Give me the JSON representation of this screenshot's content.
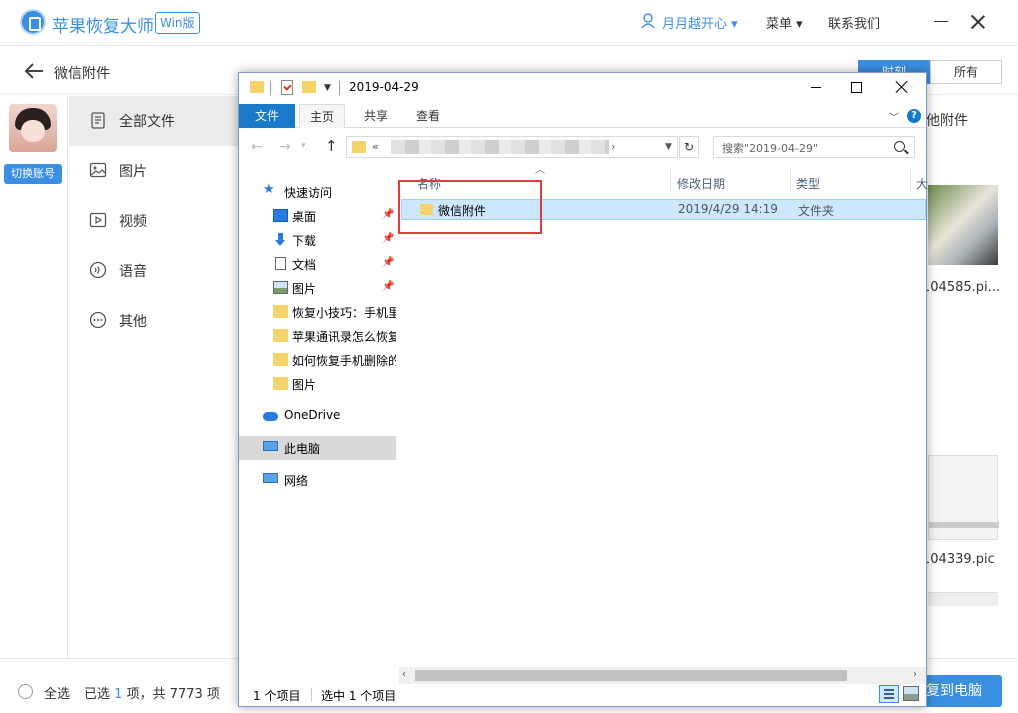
{
  "app": {
    "name": "苹果恢复大师",
    "badge": "Win版",
    "user": "月月越开心",
    "menu": "菜单",
    "contact": "联系我们"
  },
  "subbar": {
    "title": "微信附件",
    "seg_time": "时刻",
    "seg_all": "所有"
  },
  "sidebar": {
    "switch_account": "切换账号",
    "categories": [
      {
        "label": "全部文件",
        "icon": "document-icon",
        "active": true
      },
      {
        "label": "图片",
        "icon": "image-icon",
        "active": false
      },
      {
        "label": "视频",
        "icon": "video-icon",
        "active": false
      },
      {
        "label": "语音",
        "icon": "audio-icon",
        "active": false
      },
      {
        "label": "其他",
        "icon": "more-icon",
        "active": false
      }
    ]
  },
  "right_panel": {
    "label": "他附件",
    "thumb1_name": "104585.pi...",
    "thumb2_name": "104339.pic"
  },
  "bottom": {
    "select_all": "全选",
    "selected_prefix": "已选",
    "selected_count": "1",
    "selected_suffix": "项，共 7773 项",
    "recover_button": "复到电脑"
  },
  "explorer": {
    "title": "2019-04-29",
    "ribbon_tabs": [
      "文件",
      "主页",
      "共享",
      "查看"
    ],
    "address_prefix": "«",
    "search_placeholder": "搜索\"2019-04-29\"",
    "nav_items": [
      {
        "label": "快速访问",
        "icon": "star-icon"
      },
      {
        "label": "桌面",
        "icon": "desktop-icon",
        "pinned": true
      },
      {
        "label": "下载",
        "icon": "download-icon",
        "pinned": true
      },
      {
        "label": "文档",
        "icon": "document-icon",
        "pinned": true
      },
      {
        "label": "图片",
        "icon": "pictures-icon",
        "pinned": true
      },
      {
        "label": "恢复小技巧：手机里",
        "icon": "folder-icon"
      },
      {
        "label": "苹果通讯录怎么恢复",
        "icon": "folder-icon"
      },
      {
        "label": "如何恢复手机删除的",
        "icon": "folder-icon"
      },
      {
        "label": "图片",
        "icon": "folder-icon"
      },
      {
        "label": "OneDrive",
        "icon": "cloud-icon"
      },
      {
        "label": "此电脑",
        "icon": "computer-icon",
        "selected": true
      },
      {
        "label": "网络",
        "icon": "network-icon"
      }
    ],
    "columns": [
      "名称",
      "修改日期",
      "类型",
      "大"
    ],
    "rows": [
      {
        "name": "微信附件",
        "date": "2019/4/29 14:19",
        "type": "文件夹"
      }
    ],
    "status_count": "1 个项目",
    "status_selected": "选中 1 个项目"
  },
  "colors": {
    "accent": "#3b8fe2",
    "ribbon_file": "#1979ca",
    "selection": "#cce8ff",
    "highlight": "#e03c3c"
  }
}
